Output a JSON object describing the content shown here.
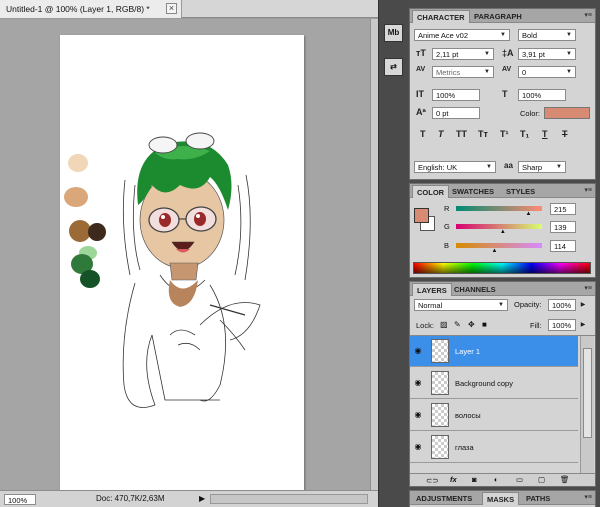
{
  "document": {
    "tab_title": "Untitled-1 @ 100% (Layer 1, RGB/8) *",
    "close_glyph": "×",
    "zoom": "100%",
    "doc_info": "Doc: 470,7K/2,63M",
    "palette_swatches": [
      "#f1d6b8",
      "#d9a77a",
      "#9c6a37",
      "#3e2a1c",
      "#9ed69a",
      "#2f7a3a",
      "#165228"
    ]
  },
  "icon_strip": {
    "btn1": "Mb",
    "btn2": "⇄"
  },
  "character_panel": {
    "tabs": [
      "CHARACTER",
      "PARAGRAPH"
    ],
    "font_family": "Anime Ace v02",
    "font_style": "Bold",
    "font_size": "2,11 pt",
    "leading": "3,91 pt",
    "kerning": "Metrics",
    "tracking": "0",
    "vertical_scale": "100%",
    "horizontal_scale": "100%",
    "baseline_shift": "0 pt",
    "color_label": "Color:",
    "color_value": "#d68b72",
    "style_buttons": [
      "T",
      "T",
      "TT",
      "Tт",
      "T¹",
      "T₁",
      "T",
      "T"
    ],
    "language": "English: UK",
    "aa_label": "a",
    "antialias": "Sharp"
  },
  "color_panel": {
    "tabs": [
      "COLOR",
      "SWATCHES",
      "STYLES"
    ],
    "r_label": "R",
    "g_label": "G",
    "b_label": "B",
    "r_value": "215",
    "g_value": "139",
    "b_value": "114",
    "r": 215,
    "g": 139,
    "b": 114,
    "foreground": "#d68b72"
  },
  "layers_panel": {
    "tabs": [
      "LAYERS",
      "CHANNELS"
    ],
    "blend_mode": "Normal",
    "opacity_label": "Opacity:",
    "opacity": "100%",
    "lock_label": "Lock:",
    "fill_label": "Fill:",
    "fill": "100%",
    "layers": [
      {
        "name": "Layer 1",
        "selected": true
      },
      {
        "name": "Background copy",
        "selected": false
      },
      {
        "name": "волосы",
        "selected": false
      },
      {
        "name": "глаза",
        "selected": false
      }
    ],
    "footer_icons": [
      "link-icon",
      "fx-icon",
      "mask-icon",
      "adjustment-icon",
      "folder-icon",
      "new-layer-icon",
      "trash-icon"
    ]
  },
  "bottom_panel": {
    "tabs": [
      "ADJUSTMENTS",
      "MASKS",
      "PATHS"
    ]
  }
}
